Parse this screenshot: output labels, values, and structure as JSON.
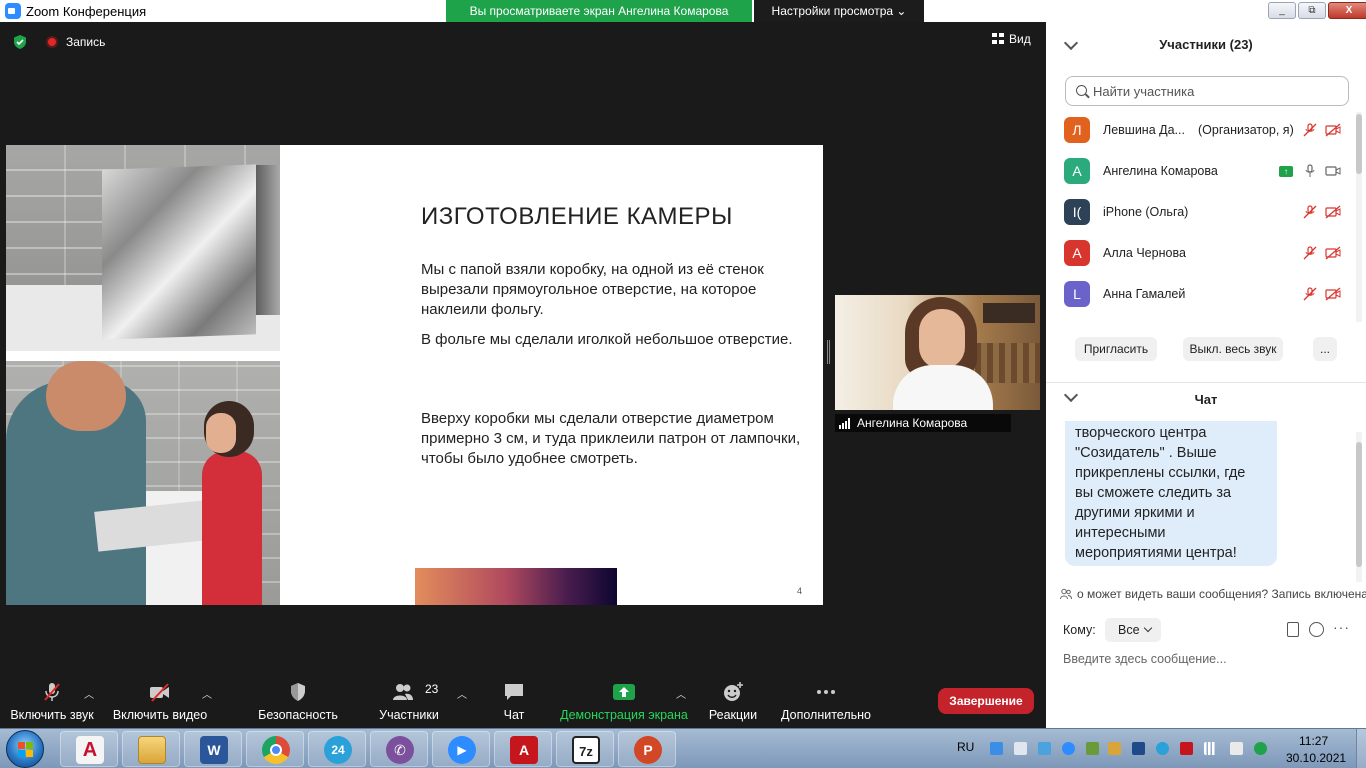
{
  "titlebar": {
    "app_title": "Zoom Конференция",
    "viewing_banner": "Вы просматриваете экран Ангелина Комарова",
    "view_settings": "Настройки просмотра ⌄",
    "buttons": [
      "_",
      "⧉",
      "X"
    ]
  },
  "meeting": {
    "record_label": "Запись",
    "view_label": "Вид"
  },
  "slide": {
    "title": "ИЗГОТОВЛЕНИЕ КАМЕРЫ",
    "para1": "Мы с папой взяли коробку, на одной из её стенок вырезали прямоугольное отверстие, на которое наклеили фольгу.",
    "para2": "В фольге мы сделали иголкой небольшое отверстие.",
    "para3": "Вверху коробки мы сделали отверстие диаметром примерно 3 см, и туда приклеили патрон от лампочки, чтобы было удобнее смотреть.",
    "page_number": "4"
  },
  "thumbnail": {
    "name": "Ангелина Комарова"
  },
  "toolbar": {
    "audio": "Включить звук",
    "video": "Включить видео",
    "security": "Безопасность",
    "participants": "Участники",
    "participants_count": "23",
    "chat": "Чат",
    "share": "Демонстрация экрана",
    "reactions": "Реакции",
    "more": "Дополнительно",
    "end": "Завершение"
  },
  "participants_panel": {
    "title": "Участники (23)",
    "search_placeholder": "Найти участника",
    "list": [
      {
        "initial": "Л",
        "name": "Левшина Да...",
        "role": "(Организатор, я)",
        "color": "#e0621e"
      },
      {
        "initial": "А",
        "name": "Ангелина Комарова",
        "role": "",
        "color": "#2bab7b"
      },
      {
        "initial": "I(",
        "name": "iPhone (Ольга)",
        "role": "",
        "color": "#2d4257"
      },
      {
        "initial": "А",
        "name": "Алла Чернова",
        "role": "",
        "color": "#d9352f"
      },
      {
        "initial": "L",
        "name": "Анна Гамалей",
        "role": "",
        "color": "#6b63c9"
      }
    ],
    "invite_label": "Пригласить",
    "mute_all_label": "Выкл. весь звук",
    "more_label": "..."
  },
  "chat_panel": {
    "title": "Чат",
    "message": "творческого центра \"Созидатель\" . Выше прикреплены ссылки, где вы сможете следить за другими яркими и интересными мероприятиями центра!",
    "notice": "о может видеть ваши сообщения? Запись включена",
    "to_label": "Кому:",
    "to_value": "Все",
    "more_label": "···",
    "input_placeholder": "Введите здесь сообщение..."
  },
  "taskbar": {
    "apps": [
      {
        "name": "autocad",
        "glyph": "A",
        "color": "#c8102e"
      },
      {
        "name": "file-explorer",
        "glyph": "",
        "color": "#e8b84a"
      },
      {
        "name": "word",
        "glyph": "W",
        "color": "#2b579a"
      },
      {
        "name": "chrome",
        "glyph": "",
        "color": "#dd4b39"
      },
      {
        "name": "24-app",
        "glyph": "24",
        "color": "#2aa1d8"
      },
      {
        "name": "viber",
        "glyph": "✆",
        "color": "#7b519d"
      },
      {
        "name": "zoom",
        "glyph": "▶",
        "color": "#2d8cff"
      },
      {
        "name": "acrobat",
        "glyph": "A",
        "color": "#c4161c"
      },
      {
        "name": "7zip",
        "glyph": "7z",
        "color": "#222222"
      },
      {
        "name": "powerpoint",
        "glyph": "P",
        "color": "#d24726"
      }
    ],
    "lang": "RU",
    "time": "11:27",
    "date": "30.10.2021"
  }
}
